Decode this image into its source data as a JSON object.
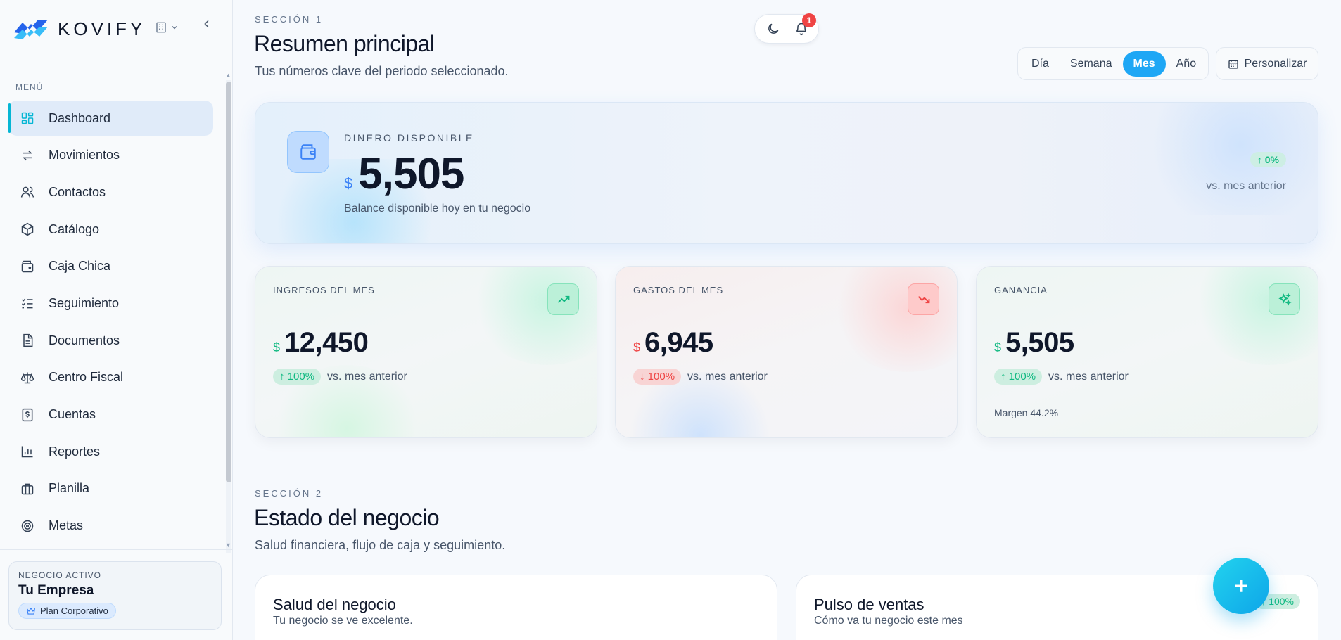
{
  "brand": {
    "name": "KOVIFY"
  },
  "sidebar": {
    "menu_label": "MENÚ",
    "items": [
      {
        "label": "Dashboard",
        "icon": "grid-icon",
        "active": true
      },
      {
        "label": "Movimientos",
        "icon": "arrows-exchange-icon"
      },
      {
        "label": "Contactos",
        "icon": "users-icon"
      },
      {
        "label": "Catálogo",
        "icon": "package-icon"
      },
      {
        "label": "Caja Chica",
        "icon": "wallet-icon"
      },
      {
        "label": "Seguimiento",
        "icon": "checklist-icon"
      },
      {
        "label": "Documentos",
        "icon": "document-icon"
      },
      {
        "label": "Centro Fiscal",
        "icon": "scale-icon"
      },
      {
        "label": "Cuentas",
        "icon": "receipt-dollar-icon"
      },
      {
        "label": "Reportes",
        "icon": "bar-chart-icon"
      },
      {
        "label": "Planilla",
        "icon": "briefcase-icon"
      },
      {
        "label": "Metas",
        "icon": "target-icon"
      }
    ],
    "business": {
      "label": "NEGOCIO ACTIVO",
      "name": "Tu Empresa",
      "plan": "Plan Corporativo"
    }
  },
  "header": {
    "notification_count": "1"
  },
  "section1": {
    "label": "SECCIÓN 1",
    "title": "Resumen principal",
    "subtitle": "Tus números clave del periodo seleccionado.",
    "ranges": [
      "Día",
      "Semana",
      "Mes",
      "Año"
    ],
    "active_range": "Mes",
    "customize_label": "Personalizar",
    "hero": {
      "label": "DINERO DISPONIBLE",
      "currency": "$",
      "amount": "5,505",
      "description": "Balance disponible hoy en tu negocio",
      "change": "0%",
      "change_sub": "vs. mes anterior"
    },
    "stats": [
      {
        "label": "INGRESOS DEL MES",
        "currency": "$",
        "amount": "12,450",
        "change": "100%",
        "direction": "up",
        "vs": "vs. mes anterior",
        "tone": "green",
        "icon": "trend-up-icon"
      },
      {
        "label": "GASTOS DEL MES",
        "currency": "$",
        "amount": "6,945",
        "change": "100%",
        "direction": "down",
        "vs": "vs. mes anterior",
        "tone": "red",
        "icon": "trend-down-icon"
      },
      {
        "label": "GANANCIA",
        "currency": "$",
        "amount": "5,505",
        "change": "100%",
        "direction": "up",
        "vs": "vs. mes anterior",
        "tone": "green",
        "icon": "sparkles-icon",
        "margin": "Margen 44.2%"
      }
    ]
  },
  "section2": {
    "label": "SECCIÓN 2",
    "title": "Estado del negocio",
    "subtitle": "Salud financiera, flujo de caja y seguimiento.",
    "cards": [
      {
        "title": "Salud del negocio",
        "subtitle": "Tu negocio se ve excelente."
      },
      {
        "title": "Pulso de ventas",
        "subtitle": "Cómo va tu negocio este mes",
        "chip": "100%"
      }
    ]
  },
  "colors": {
    "accent": "#06b6d4",
    "primary": "#1ea7f5",
    "positive": "#10b981",
    "negative": "#ef4444"
  }
}
